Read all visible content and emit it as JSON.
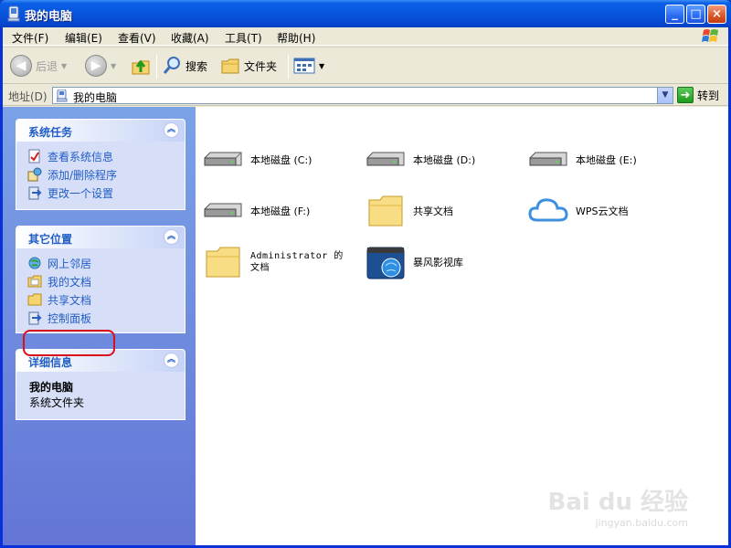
{
  "window": {
    "title": "我的电脑",
    "minimize": "_",
    "maximize": "□",
    "close": "×"
  },
  "menubar": {
    "items": [
      "文件(F)",
      "编辑(E)",
      "查看(V)",
      "收藏(A)",
      "工具(T)",
      "帮助(H)"
    ]
  },
  "toolbar": {
    "back_label": "后退",
    "search_label": "搜索",
    "folders_label": "文件夹"
  },
  "address": {
    "label": "地址(D)",
    "value": "我的电脑",
    "go_label": "转到"
  },
  "sidebar": {
    "system_tasks": {
      "title": "系统任务",
      "items": [
        "查看系统信息",
        "添加/删除程序",
        "更改一个设置"
      ]
    },
    "other_places": {
      "title": "其它位置",
      "items": [
        "网上邻居",
        "我的文档",
        "共享文档",
        "控制面板"
      ]
    },
    "details": {
      "title": "详细信息",
      "name": "我的电脑",
      "description": "系统文件夹"
    }
  },
  "content": {
    "items": [
      {
        "label": "本地磁盘 (C:)",
        "icon": "hard-disk-icon"
      },
      {
        "label": "本地磁盘 (D:)",
        "icon": "hard-disk-icon"
      },
      {
        "label": "本地磁盘 (E:)",
        "icon": "hard-disk-icon"
      },
      {
        "label": "本地磁盘 (F:)",
        "icon": "hard-disk-icon"
      },
      {
        "label": "共享文档",
        "icon": "folder-icon"
      },
      {
        "label": "WPS云文档",
        "icon": "cloud-icon"
      },
      {
        "label": "Administrator 的文档",
        "icon": "folder-icon"
      },
      {
        "label": "暴风影视库",
        "icon": "media-library-icon"
      }
    ]
  },
  "watermark": {
    "brand": "Bai du 经验",
    "url": "jingyan.baidu.com"
  },
  "colors": {
    "titlebar": "#0855dd",
    "sidebar_link": "#215dc6",
    "highlight_ring": "#d90f1e"
  }
}
